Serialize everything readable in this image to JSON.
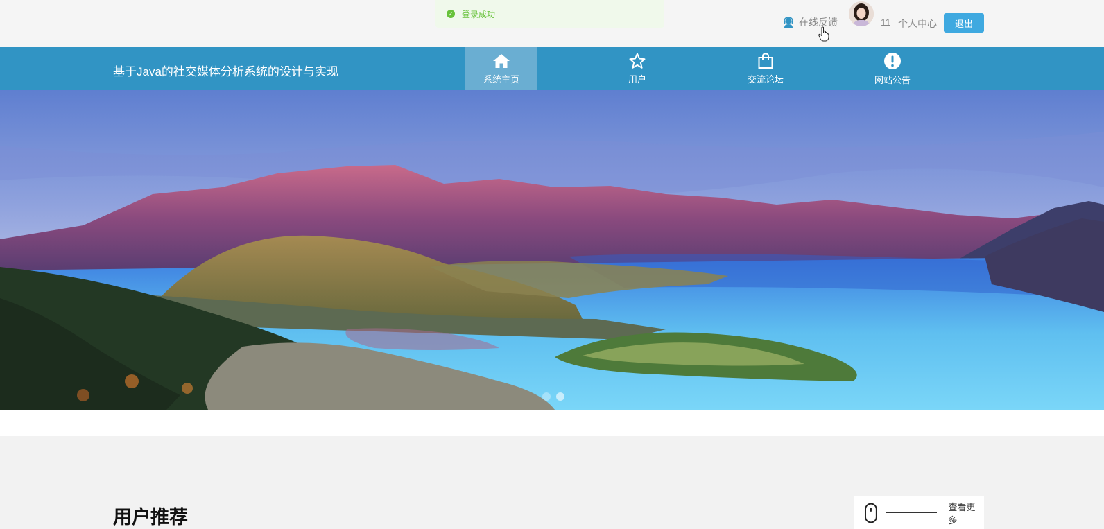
{
  "toast": {
    "message": "登录成功"
  },
  "header": {
    "feedback_label": "在线反馈",
    "username": "11",
    "personal_center": "个人中心",
    "logout_label": "退出"
  },
  "nav": {
    "site_title": "基于Java的社交媒体分析系统的设计与实现",
    "items": [
      {
        "label": "系统主页",
        "icon": "home-icon"
      },
      {
        "label": "用户",
        "icon": "star-icon"
      },
      {
        "label": "交流论坛",
        "icon": "shopping-bag-icon"
      },
      {
        "label": "网站公告",
        "icon": "exclamation-icon"
      }
    ]
  },
  "colors": {
    "nav_bg": "#3194c4",
    "nav_active": "#6aaed2",
    "logout_btn": "#3fa9e0",
    "toast_text": "#67c23a"
  },
  "section": {
    "title": "用户推荐",
    "more_label": "查看更多"
  }
}
